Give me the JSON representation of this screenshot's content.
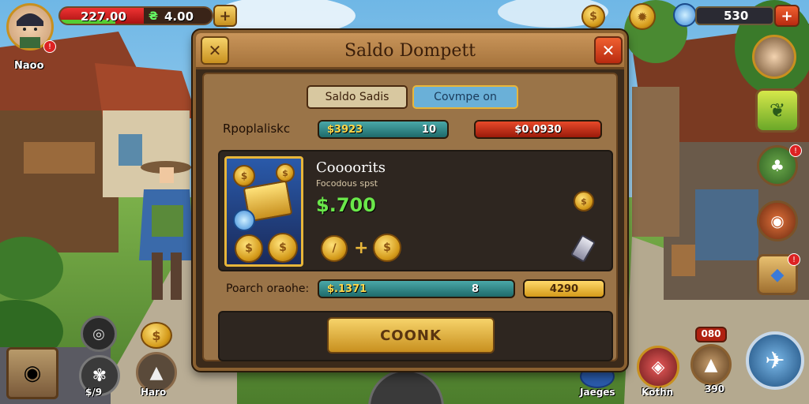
{
  "hud": {
    "player_name": "Naoo",
    "hp_value": "227.00",
    "hp_fraction": 0.55,
    "secondary_value": "4.00",
    "gem_value": "530",
    "add_symbol": "+"
  },
  "modal": {
    "title": "Saldo Dompett",
    "close_symbol": "✕",
    "tabs": [
      {
        "label": "Saldo Sadis",
        "active": true
      },
      {
        "label": "Covmpe on",
        "active": false
      }
    ],
    "row1": {
      "label": "Rpoplaliskc",
      "bar_left": "$3923",
      "bar_right": "10",
      "red_value": "$0.0930"
    },
    "card": {
      "title": "Coooorits",
      "subtitle": "Focodous spst",
      "amount": "$.700"
    },
    "row2": {
      "label": "Poarch oraohe:",
      "bar_left": "$.1371",
      "bar_right": "8",
      "gold_value": "4290"
    },
    "confirm_label": "COONK"
  },
  "bottom": {
    "left_labels": [
      "$/9",
      "Haro"
    ],
    "right_labels": [
      "Jaeges",
      "Kothn",
      "390"
    ],
    "counter_badge": "080"
  },
  "colors": {
    "accent_gold": "#e8b63a",
    "accent_red": "#d8381a",
    "panel_dark": "#2e2620",
    "frame_wood": "#8a6030"
  },
  "icons": [
    "avatar",
    "gold-coin-icon",
    "gem-icon",
    "leaf-icon",
    "map-icon",
    "pet-icon",
    "helmet-icon",
    "bag-icon",
    "sword-icon"
  ]
}
